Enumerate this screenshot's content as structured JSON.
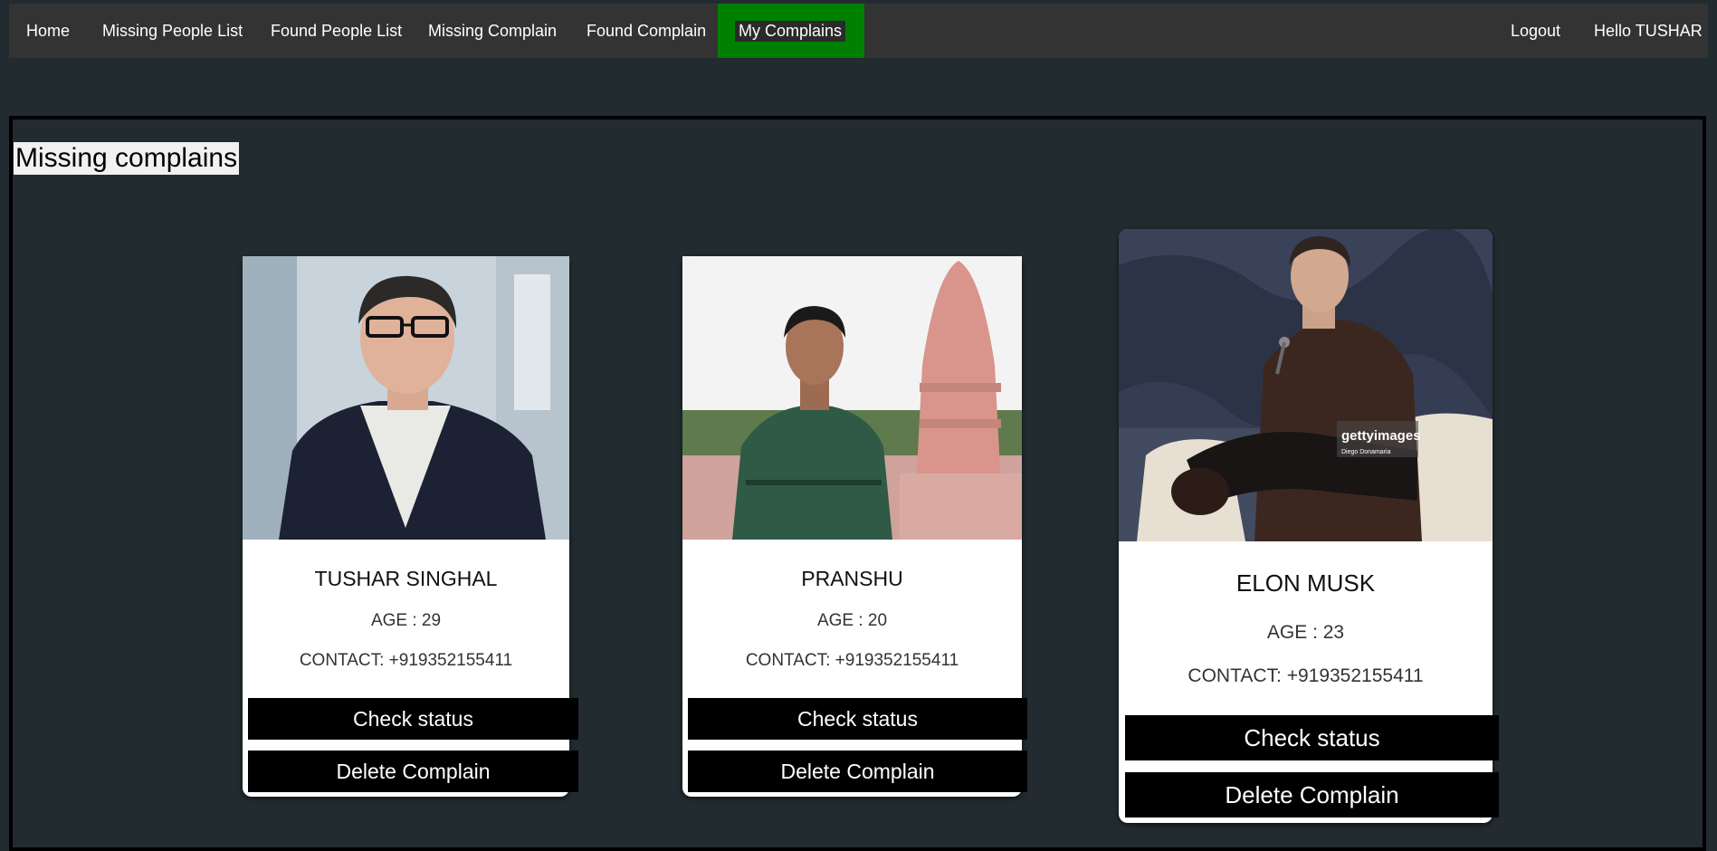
{
  "nav": {
    "home": "Home",
    "missing_list": "Missing People List",
    "found_list": "Found People List",
    "missing_complain": "Missing Complain",
    "found_complain": "Found Complain",
    "my_complains": "My Complains",
    "logout": "Logout",
    "greeting": "Hello TUSHAR",
    "active_color": "#008000"
  },
  "section": {
    "title": "Missing complains"
  },
  "cards": [
    {
      "name": "TUSHAR SINGHAL",
      "age": "AGE : 29",
      "contact": "CONTACT: +919352155411",
      "check_label": "Check status",
      "delete_label": "Delete Complain"
    },
    {
      "name": "PRANSHU",
      "age": "AGE : 20",
      "contact": "CONTACT: +919352155411",
      "check_label": "Check status",
      "delete_label": "Delete Complain"
    },
    {
      "name": "ELON MUSK",
      "age": "AGE : 23",
      "contact": "CONTACT: +919352155411",
      "check_label": "Check status",
      "delete_label": "Delete Complain",
      "watermark": "gettyimages",
      "watermark_credit": "Diego Donamaria"
    }
  ]
}
